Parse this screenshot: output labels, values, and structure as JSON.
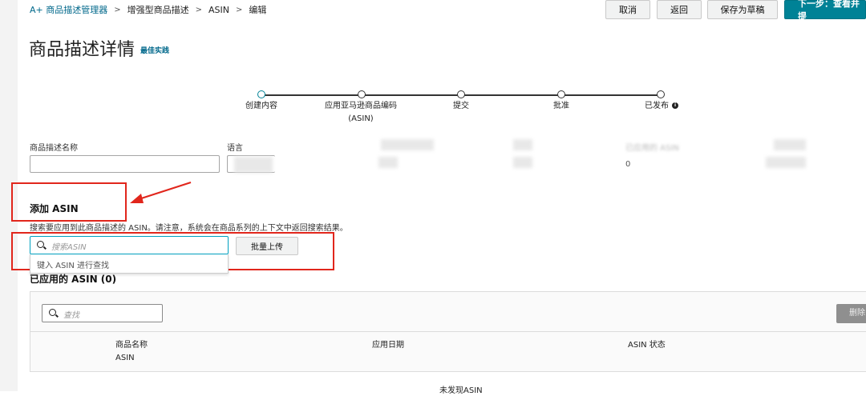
{
  "breadcrumb": {
    "items": [
      "A+ 商品描述管理器",
      "增强型商品描述",
      "ASIN",
      "编辑"
    ]
  },
  "toolbar": {
    "cancel": "取消",
    "back": "返回",
    "save_draft": "保存为草稿",
    "next": "下一步：查看并提"
  },
  "page": {
    "title": "商品描述详情",
    "best_practice": "最佳实践"
  },
  "stepper": {
    "steps": [
      "创建内容",
      "应用亚马逊商品编码",
      "提交",
      "批准",
      "已发布"
    ],
    "step2_sub": "(ASIN)",
    "current": 0
  },
  "form": {
    "name_label": "商品描述名称",
    "language_label": "语言",
    "applied_label": "已应用的 ASIN",
    "applied_value": "0"
  },
  "add_asin": {
    "heading": "添加 ASIN",
    "help": "搜索要应用到此商品描述的 ASIN。请注意，系统会在商品系列的上下文中返回搜索结果。",
    "search_placeholder": "搜索ASIN",
    "bulk_upload": "批量上传",
    "suggestion": "键入 ASIN 进行查找"
  },
  "applied": {
    "heading": "已应用的 ASIN (0)",
    "search_placeholder": "查找",
    "remove": "删除",
    "columns": {
      "name": "商品名称",
      "name_sub": "ASIN",
      "date": "应用日期",
      "status": "ASIN 状态"
    },
    "empty": "未发现ASIN"
  },
  "colors": {
    "accent": "#008296",
    "link": "#00688b",
    "annotation_red": "#e1261c"
  }
}
